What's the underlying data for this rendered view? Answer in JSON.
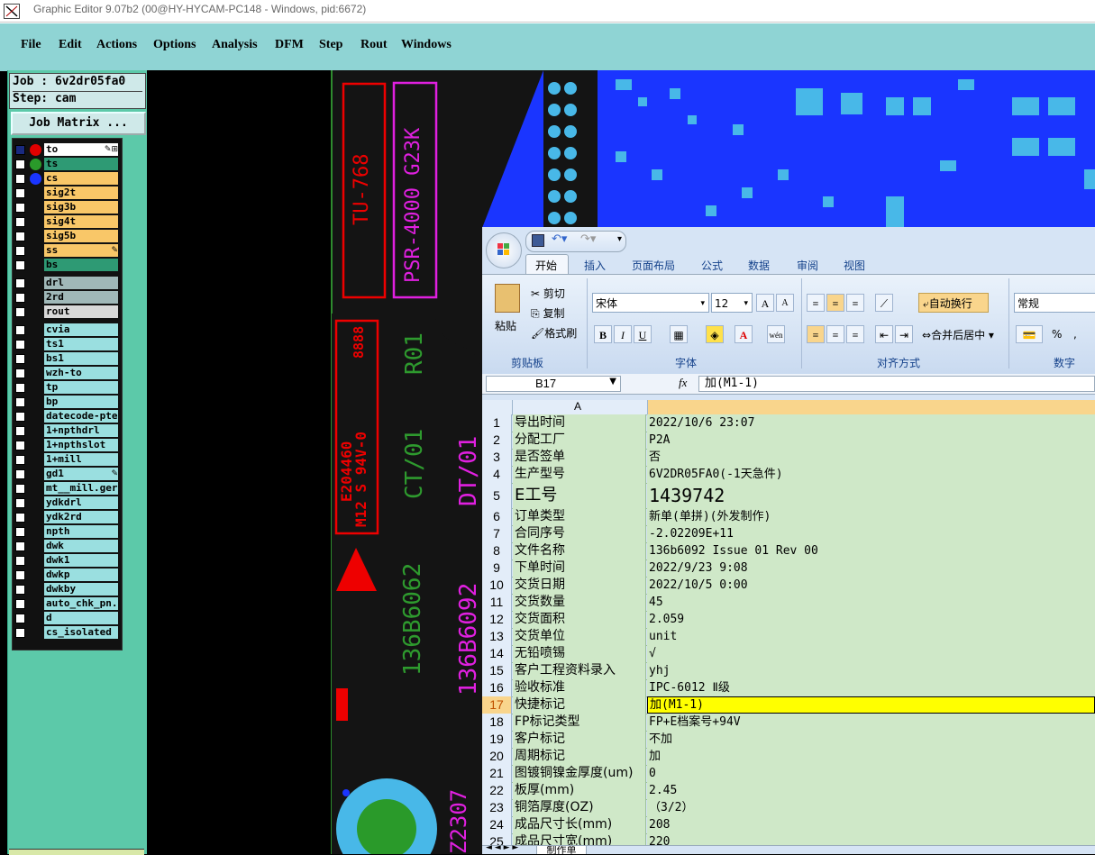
{
  "window": {
    "title": "Graphic Editor 9.07b2 (00@HY-HYCAM-PC148 - Windows, pid:6672)"
  },
  "menu": [
    "File",
    "Edit",
    "Actions",
    "Options",
    "Analysis",
    "DFM",
    "Step",
    "Rout",
    "Windows"
  ],
  "job": {
    "job_line": "Job : 6v2dr05fa0",
    "step_line": "Step: cam",
    "matrix_button": "Job Matrix ..."
  },
  "layers": [
    {
      "name": "to",
      "color": "#ffffff",
      "dot": "#e00000",
      "pen": "✎⊞"
    },
    {
      "name": "ts",
      "color": "#2e9a74",
      "dot": "#2a9a2a",
      "pen": ""
    },
    {
      "name": "cs",
      "color": "#f9c768",
      "dot": "#1a35ff",
      "pen": ""
    },
    {
      "name": "sig2t",
      "color": "#f9c768",
      "dot": "",
      "pen": ""
    },
    {
      "name": "sig3b",
      "color": "#f9c768",
      "dot": "",
      "pen": ""
    },
    {
      "name": "sig4t",
      "color": "#f9c768",
      "dot": "",
      "pen": ""
    },
    {
      "name": "sig5b",
      "color": "#f9c768",
      "dot": "",
      "pen": ""
    },
    {
      "name": "ss",
      "color": "#f9c768",
      "dot": "",
      "pen": "✎"
    },
    {
      "name": "bs",
      "color": "#2e9a74",
      "dot": "",
      "pen": ""
    },
    {
      "name": "drl",
      "color": "#a0b8b8",
      "dot": "",
      "pen": ""
    },
    {
      "name": "2rd",
      "color": "#a0b8b8",
      "dot": "",
      "pen": ""
    },
    {
      "name": "rout",
      "color": "#d8d8d8",
      "dot": "",
      "pen": ""
    },
    {
      "name": "cvia",
      "color": "#9adfe0",
      "dot": "",
      "pen": ""
    },
    {
      "name": "ts1",
      "color": "#9adfe0",
      "dot": "",
      "pen": ""
    },
    {
      "name": "bs1",
      "color": "#9adfe0",
      "dot": "",
      "pen": ""
    },
    {
      "name": "wzh-to",
      "color": "#9adfe0",
      "dot": "",
      "pen": ""
    },
    {
      "name": "tp",
      "color": "#9adfe0",
      "dot": "",
      "pen": ""
    },
    {
      "name": "bp",
      "color": "#9adfe0",
      "dot": "",
      "pen": ""
    },
    {
      "name": "datecode-pte",
      "color": "#9adfe0",
      "dot": "",
      "pen": ""
    },
    {
      "name": "1+npthdrl",
      "color": "#9adfe0",
      "dot": "",
      "pen": ""
    },
    {
      "name": "1+npthslot",
      "color": "#9adfe0",
      "dot": "",
      "pen": ""
    },
    {
      "name": "1+mill",
      "color": "#9adfe0",
      "dot": "",
      "pen": ""
    },
    {
      "name": "gd1",
      "color": "#9adfe0",
      "dot": "",
      "pen": "✎"
    },
    {
      "name": "mt__mill.ger",
      "color": "#9adfe0",
      "dot": "",
      "pen": ""
    },
    {
      "name": "ydkdrl",
      "color": "#9adfe0",
      "dot": "",
      "pen": ""
    },
    {
      "name": "ydk2rd",
      "color": "#9adfe0",
      "dot": "",
      "pen": ""
    },
    {
      "name": "npth",
      "color": "#9adfe0",
      "dot": "",
      "pen": ""
    },
    {
      "name": "dwk",
      "color": "#9adfe0",
      "dot": "",
      "pen": ""
    },
    {
      "name": "dwk1",
      "color": "#9adfe0",
      "dot": "",
      "pen": ""
    },
    {
      "name": "dwkp",
      "color": "#9adfe0",
      "dot": "",
      "pen": ""
    },
    {
      "name": "dwkby",
      "color": "#9adfe0",
      "dot": "",
      "pen": ""
    },
    {
      "name": "auto_chk_pn.",
      "color": "#9adfe0",
      "dot": "",
      "pen": ""
    },
    {
      "name": "d",
      "color": "#9adfe0",
      "dot": "",
      "pen": ""
    },
    {
      "name": "cs_isolated",
      "color": "#9adfe0",
      "dot": "",
      "pen": ""
    }
  ],
  "pcb_text": {
    "tu": "TU-768",
    "psr": "PSR-4000 G23K",
    "r01": "R01",
    "ct01": "CT/01",
    "pn_green": "136B6062",
    "ul1": "E204460",
    "ul2": "M12 S 94V-0",
    "date": "8888",
    "dt01": "DT/01",
    "pn_magenta": "136B6092",
    "z2307": "Z2307"
  },
  "excel": {
    "tabs": [
      "开始",
      "插入",
      "页面布局",
      "公式",
      "数据",
      "审阅",
      "视图"
    ],
    "clipboard": {
      "paste": "粘贴",
      "cut": "剪切",
      "copy": "复制",
      "format": "格式刷",
      "group": "剪贴板"
    },
    "font": {
      "name": "宋体",
      "size": "12",
      "group": "字体",
      "bold": "B",
      "italic": "I",
      "underline": "U",
      "wen": "wén"
    },
    "align": {
      "wrap": "自动换行",
      "merge": "合并后居中",
      "group": "对齐方式"
    },
    "number": {
      "format": "常规",
      "group": "数字",
      "percent": "%",
      "comma": ","
    },
    "name_box": "B17",
    "fx": "fx",
    "formula": "加(M1-1)",
    "col_a": "A",
    "sheet_tab": "制作单",
    "rows": [
      [
        "1",
        "导出时间",
        "2022/10/6 23:07"
      ],
      [
        "2",
        "分配工厂",
        "P2A"
      ],
      [
        "3",
        "是否签单",
        "否"
      ],
      [
        "4",
        "生产型号",
        "6V2DR05FA0(-1天急件)"
      ],
      [
        "5",
        "E工号",
        "1439742"
      ],
      [
        "6",
        "订单类型",
        "新单(单拼)(外发制作)"
      ],
      [
        "7",
        "合同序号",
        "-2.02209E+11"
      ],
      [
        "8",
        "文件名称",
        "136b6092 Issue 01 Rev 00"
      ],
      [
        "9",
        "下单时间",
        "2022/9/23 9:08"
      ],
      [
        "10",
        "交货日期",
        "2022/10/5 0:00"
      ],
      [
        "11",
        "交货数量",
        "45"
      ],
      [
        "12",
        "交货面积",
        "2.059"
      ],
      [
        "13",
        "交货单位",
        "unit"
      ],
      [
        "14",
        "无铅喷锡",
        "√"
      ],
      [
        "15",
        "客户工程资料录入",
        "yhj"
      ],
      [
        "16",
        "验收标准",
        "IPC-6012 Ⅱ级"
      ],
      [
        "17",
        "快捷标记",
        "加(M1-1)"
      ],
      [
        "18",
        "FP标记类型",
        "FP+E档案号+94V"
      ],
      [
        "19",
        "客户标记",
        "不加"
      ],
      [
        "20",
        "周期标记",
        "加"
      ],
      [
        "21",
        "图镀铜镍金厚度(um)",
        "0"
      ],
      [
        "22",
        "板厚(mm)",
        "2.45"
      ],
      [
        "23",
        "铜箔厚度(OZ)",
        "（3/2）"
      ],
      [
        "24",
        "成品尺寸长(mm)",
        "208"
      ],
      [
        "25",
        "成品尺寸宽(mm)",
        "220"
      ]
    ]
  }
}
